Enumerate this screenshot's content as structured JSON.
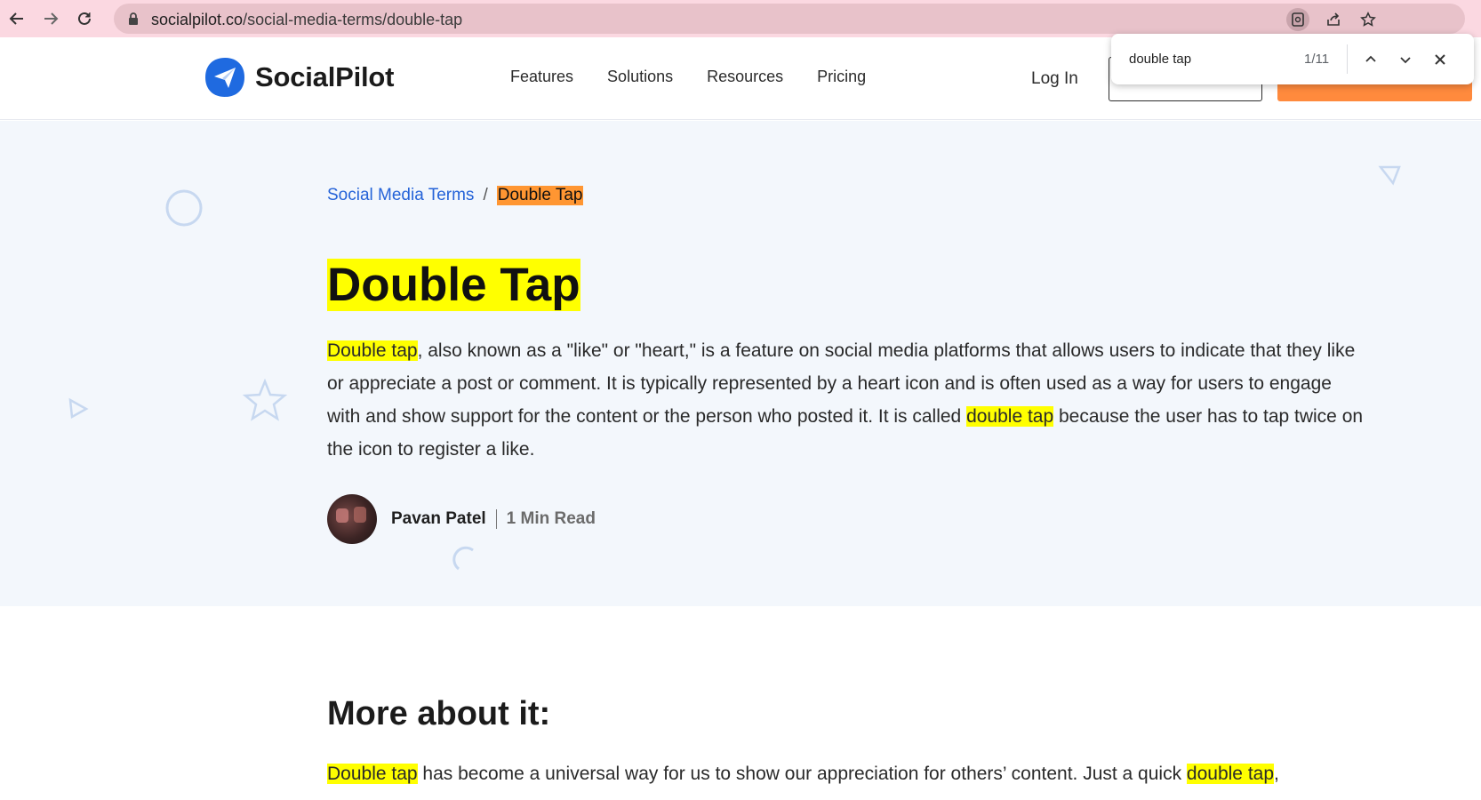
{
  "browser": {
    "url_host": "socialpilot.co",
    "url_path": "/social-media-terms/double-tap",
    "icons": [
      "back-arrow-icon",
      "forward-arrow-icon",
      "reload-icon",
      "lock-icon",
      "search-in-page-icon",
      "share-icon",
      "bookmark-star-icon"
    ]
  },
  "find_bar": {
    "query": "double tap",
    "count": "1/11"
  },
  "header": {
    "logo_text": "SocialPilot",
    "nav": [
      "Features",
      "Solutions",
      "Resources",
      "Pricing"
    ],
    "login": "Log In"
  },
  "breadcrumb": {
    "parent": "Social Media Terms",
    "separator": "/",
    "current": "Double Tap"
  },
  "article": {
    "title": "Double Tap",
    "intro": {
      "hl1": "Double tap",
      "part1": ", also known as a \"like\" or \"heart,\" is a feature on social media platforms that allows users to indicate that they like or appreciate a post or comment. It is typically represented by a heart icon and is often used as a way for users to engage with and show support for the content or the person who posted it. It is called ",
      "hl2": "double tap",
      "part2": " because the user has to tap twice on the icon to register a like."
    },
    "author_name": "Pavan Patel",
    "read_time": "1 Min Read"
  },
  "more": {
    "heading": "More about it:",
    "hl1": "Double tap",
    "part1": " has become a universal way for us to show our appreciation for others’ content. Just a quick ",
    "hl2": "double tap",
    "part2": ","
  },
  "colors": {
    "chrome_bg": "#fbd8e1",
    "hero_bg": "#f3f7fc",
    "brand_blue": "#1f6ae0",
    "link_blue": "#2563d8",
    "find_highlight": "#ffff00",
    "find_active": "#ff9632",
    "cta_orange": "#ff8a3d"
  }
}
